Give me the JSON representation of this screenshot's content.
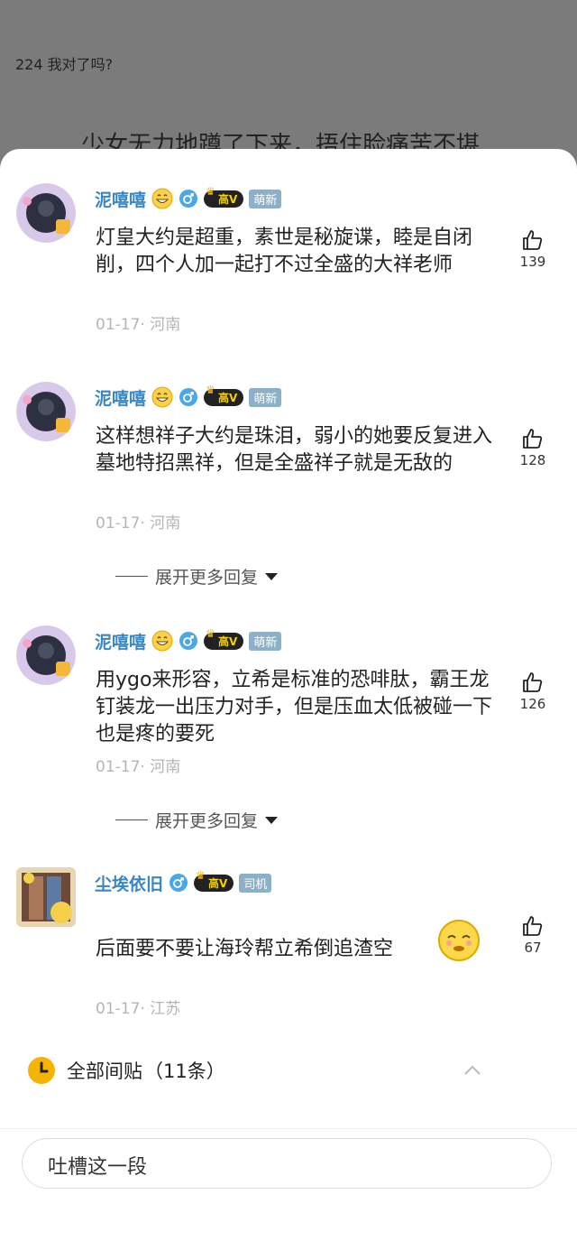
{
  "background": {
    "header_text": "224 我对了吗?",
    "body_text": "少女无力地蹲了下来，捂住脸痛苦不堪"
  },
  "comments": [
    {
      "username": "泥嘻嘻",
      "level_badge": "高V",
      "tag": "萌新",
      "text": "灯皇大约是超重，素世是秘旋谍，睦是自闭削，四个人加一起打不过全盛的大祥老师",
      "meta": "01-17· 河南",
      "likes": "139"
    },
    {
      "username": "泥嘻嘻",
      "level_badge": "高V",
      "tag": "萌新",
      "text": "这样想祥子大约是珠泪，弱小的她要反复进入墓地特招黑祥，但是全盛祥子就是无敌的",
      "meta": "01-17· 河南",
      "likes": "128",
      "expand_label": "展开更多回复"
    },
    {
      "username": "泥嘻嘻",
      "level_badge": "高V",
      "tag": "萌新",
      "text": "用ygo来形容，立希是标准的恐啡肽，霸王龙钉装龙一出压力对手，但是压血太低被碰一下也是疼的要死",
      "meta": "01-17· 河南",
      "likes": "126",
      "expand_label": "展开更多回复"
    },
    {
      "username": "尘埃依旧",
      "level_badge": "高V",
      "tag": "司机",
      "text": "后面要不要让海玲帮立希倒追渣空",
      "meta": "01-17· 江苏",
      "likes": "67"
    }
  ],
  "all_posts_label": "全部间贴",
  "all_posts_count": "（11条）",
  "input_placeholder": "吐槽这一段",
  "colors": {
    "username": "#3a86c4",
    "tag_bg": "#8cb0c7",
    "clock": "#f5b400"
  }
}
